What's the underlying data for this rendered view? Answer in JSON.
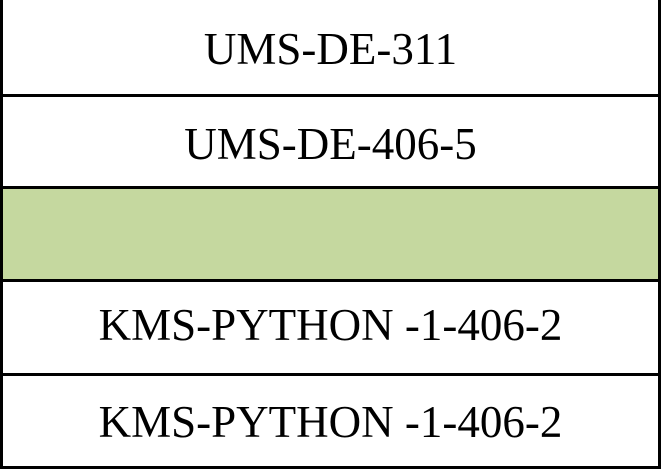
{
  "table": {
    "rows": [
      {
        "text": "UMS-DE-311"
      },
      {
        "text": "UMS-DE-406-5"
      },
      {
        "text": "",
        "highlight_color": "#c5d89f"
      },
      {
        "text": "KMS-PYTHON -1-406-2"
      },
      {
        "text": "KMS-PYTHON -1-406-2"
      }
    ]
  }
}
